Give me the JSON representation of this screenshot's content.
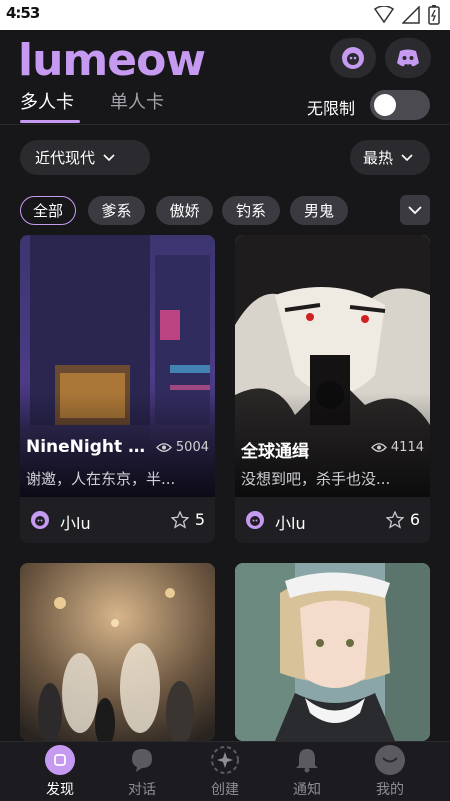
{
  "status": {
    "time": "4:53"
  },
  "header": {
    "logo": "lumeow"
  },
  "tabs": [
    {
      "label": "多人卡"
    },
    {
      "label": "单人卡"
    }
  ],
  "unlimited": {
    "label": "无限制",
    "on": false
  },
  "filters": {
    "era": "近代现代",
    "sort": "最热"
  },
  "chips": [
    "全部",
    "爹系",
    "傲娇",
    "钓系",
    "男鬼"
  ],
  "cards": [
    {
      "title": "NineNight Cl...",
      "views": "5004",
      "desc": "谢邀，人在东京，半...",
      "author": "小lu",
      "stars": "5"
    },
    {
      "title": "全球通缉",
      "views": "4114",
      "desc": "没想到吧，杀手也没...",
      "author": "小lu",
      "stars": "6"
    }
  ],
  "nav": [
    {
      "label": "发现"
    },
    {
      "label": "对话"
    },
    {
      "label": "创建"
    },
    {
      "label": "通知"
    },
    {
      "label": "我的"
    }
  ],
  "colors": {
    "accent": "#c59af0",
    "background": "#17171a"
  }
}
